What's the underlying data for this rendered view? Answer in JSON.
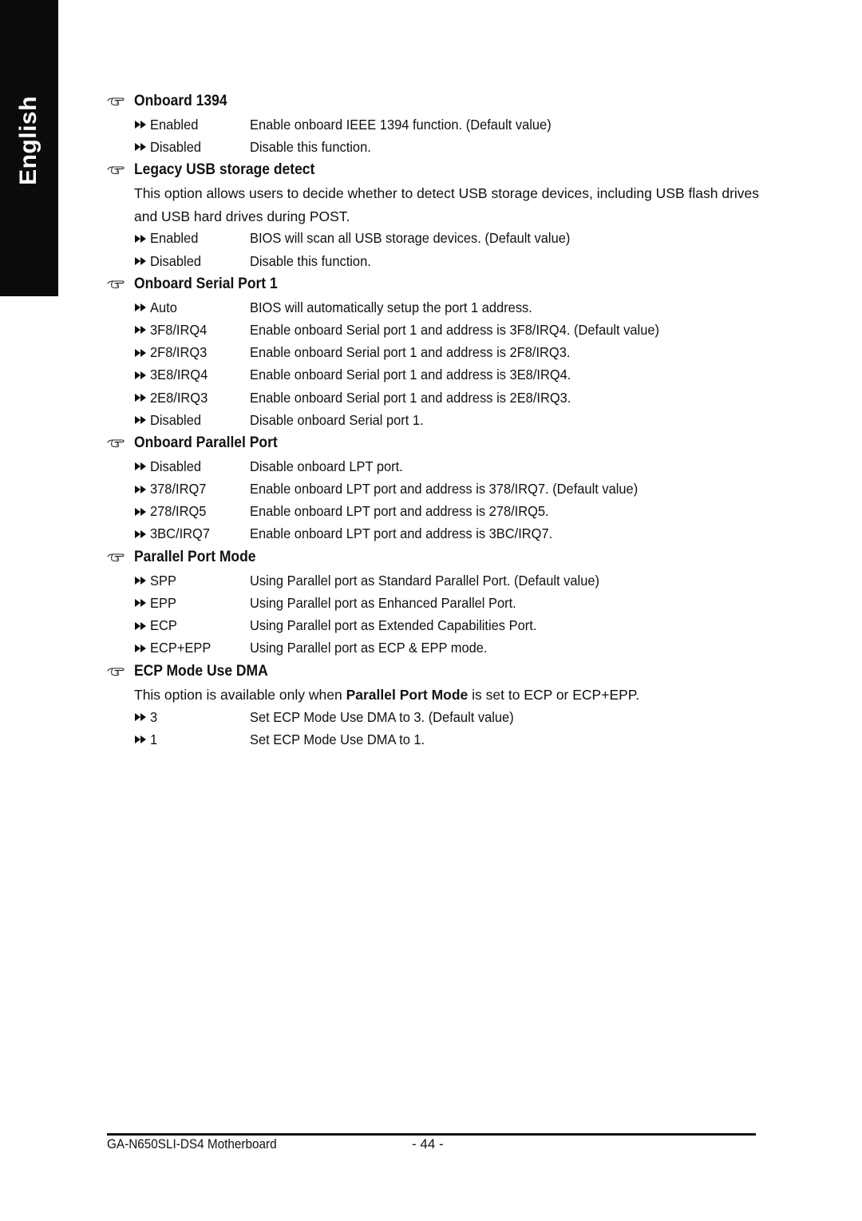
{
  "side_tab": {
    "label": "English"
  },
  "sections": [
    {
      "title": "Onboard 1394",
      "intro": null,
      "options": [
        {
          "key": "Enabled",
          "desc": "Enable onboard IEEE 1394 function. (Default value)"
        },
        {
          "key": "Disabled",
          "desc": "Disable this function."
        }
      ]
    },
    {
      "title": "Legacy USB storage detect",
      "intro": "This option allows users to decide whether to detect USB storage devices, including USB flash drives and USB hard drives during POST.",
      "options": [
        {
          "key": "Enabled",
          "desc": "BIOS will scan all USB storage devices. (Default value)"
        },
        {
          "key": "Disabled",
          "desc": "Disable this function."
        }
      ]
    },
    {
      "title": "Onboard Serial Port 1",
      "intro": null,
      "options": [
        {
          "key": "Auto",
          "desc": "BIOS will automatically setup the port 1 address."
        },
        {
          "key": "3F8/IRQ4",
          "desc": "Enable onboard Serial port 1 and address is 3F8/IRQ4. (Default value)"
        },
        {
          "key": "2F8/IRQ3",
          "desc": "Enable onboard Serial port 1 and address is 2F8/IRQ3."
        },
        {
          "key": "3E8/IRQ4",
          "desc": "Enable onboard Serial port 1 and address is 3E8/IRQ4."
        },
        {
          "key": "2E8/IRQ3",
          "desc": "Enable onboard Serial port 1 and address is 2E8/IRQ3."
        },
        {
          "key": "Disabled",
          "desc": "Disable onboard Serial port 1."
        }
      ]
    },
    {
      "title": "Onboard Parallel Port",
      "intro": null,
      "options": [
        {
          "key": "Disabled",
          "desc": "Disable onboard LPT port."
        },
        {
          "key": "378/IRQ7",
          "desc": "Enable onboard LPT port and address is 378/IRQ7. (Default value)"
        },
        {
          "key": "278/IRQ5",
          "desc": "Enable onboard LPT port and address is 278/IRQ5."
        },
        {
          "key": "3BC/IRQ7",
          "desc": "Enable onboard LPT port and address is 3BC/IRQ7."
        }
      ]
    },
    {
      "title": "Parallel Port Mode",
      "intro": null,
      "options": [
        {
          "key": "SPP",
          "desc": "Using Parallel port as Standard Parallel Port. (Default value)"
        },
        {
          "key": "EPP",
          "desc": "Using Parallel port as Enhanced Parallel Port."
        },
        {
          "key": "ECP",
          "desc": "Using Parallel port as Extended Capabilities Port."
        },
        {
          "key": "ECP+EPP",
          "desc": "Using Parallel port as ECP & EPP mode."
        }
      ]
    },
    {
      "title": "ECP Mode Use DMA",
      "intro_parts": {
        "before": "This option is available only when ",
        "bold": "Parallel Port Mode",
        "after": " is set to ECP or ECP+EPP."
      },
      "options": [
        {
          "key": "3",
          "desc": "Set ECP Mode Use DMA to 3. (Default value)"
        },
        {
          "key": "1",
          "desc": "Set ECP Mode Use DMA to 1."
        }
      ]
    }
  ],
  "footer": {
    "model": "GA-N650SLI-DS4 Motherboard",
    "page": "- 44 -"
  }
}
